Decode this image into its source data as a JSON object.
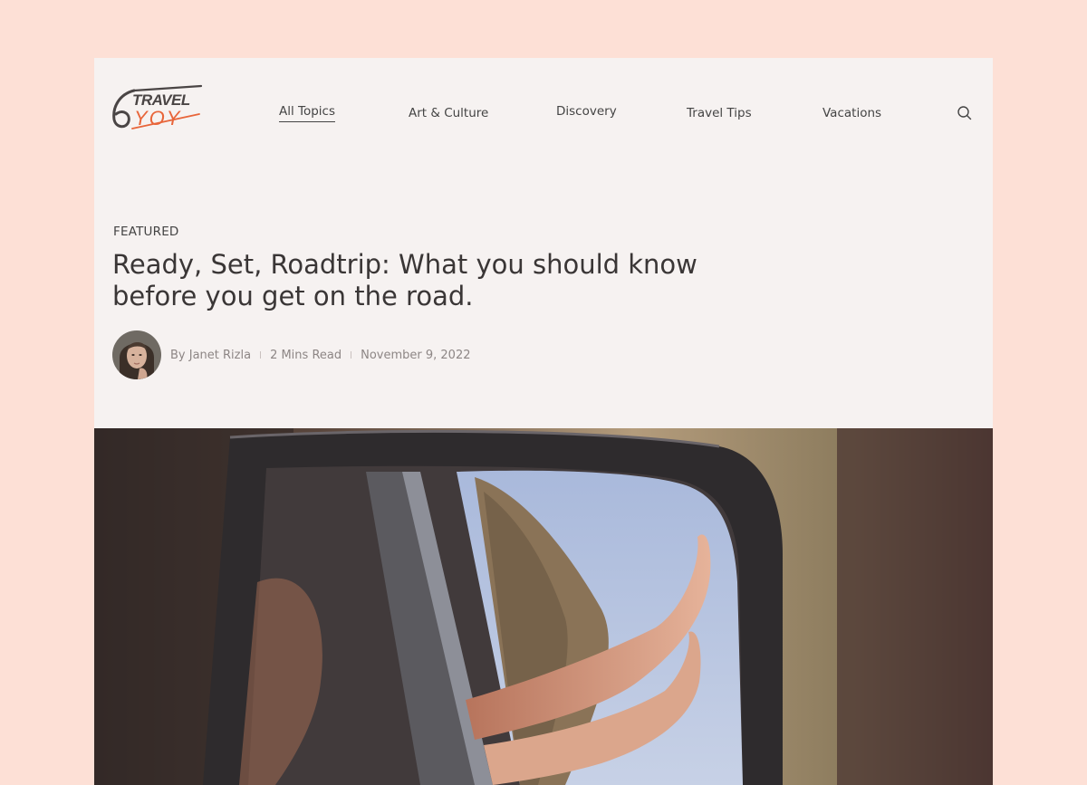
{
  "brand": {
    "logo_top": "TRAVEL",
    "logo_bottom": "YOY",
    "accent_color": "#e8653a",
    "dark_color": "#4a4545"
  },
  "nav": {
    "items": [
      {
        "label": "All Topics",
        "active": true
      },
      {
        "label": "Art & Culture",
        "active": false
      },
      {
        "label": "Discovery",
        "active": false
      },
      {
        "label": "Travel Tips",
        "active": false
      },
      {
        "label": "Vacations",
        "active": false
      }
    ],
    "search_icon": "search-icon"
  },
  "featured": {
    "eyebrow": "FEATURED",
    "title": "Ready, Set, Roadtrip: What you should know before you get on the road.",
    "author": "By Janet Rizla",
    "read_time": "2 Mins Read",
    "date": "November 9, 2022"
  },
  "colors": {
    "page_bg": "#fde0d6",
    "card_bg": "#f6f2f1",
    "text": "#3a3636",
    "muted": "#8d8685"
  }
}
